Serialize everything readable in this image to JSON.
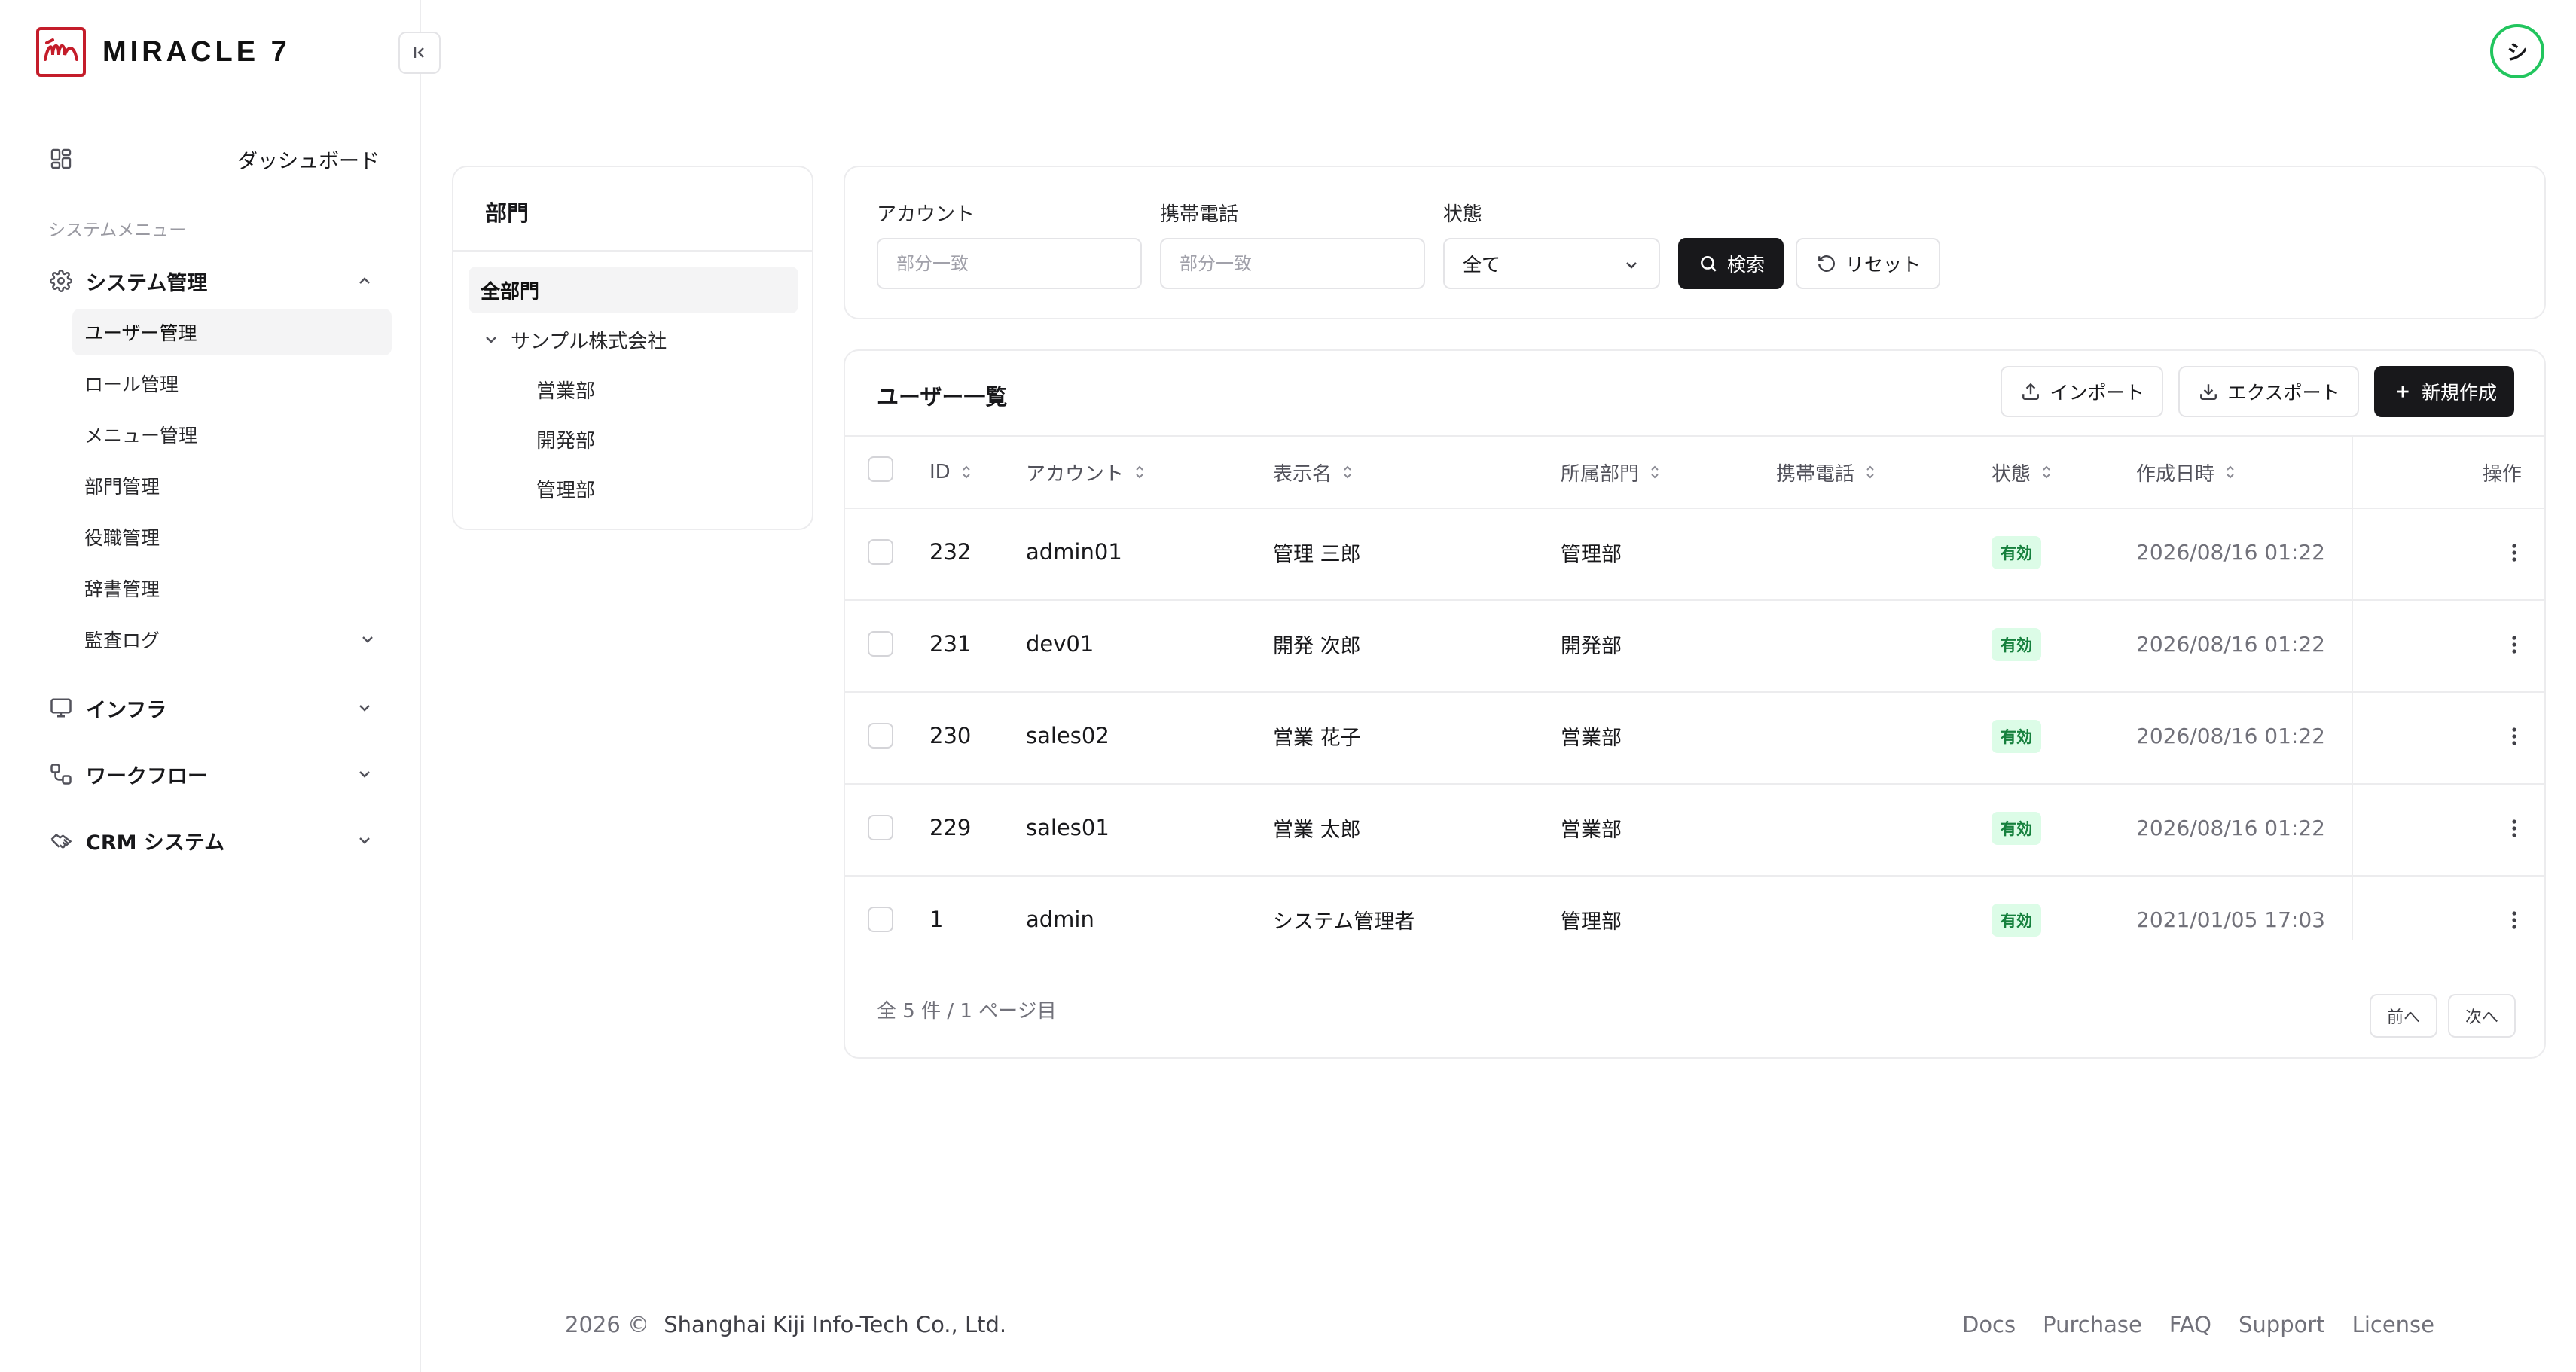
{
  "brand": {
    "name": "MIRACLE 7",
    "color": "#c41d2a"
  },
  "header": {
    "avatar_initial": "シ",
    "avatar_ring_color": "#22c55e"
  },
  "sidebar": {
    "dashboard_label": "ダッシュボード",
    "section_label": "システムメニュー",
    "system_group": {
      "label": "システム管理",
      "expanded": true,
      "items": [
        {
          "label": "ユーザー管理",
          "active": true
        },
        {
          "label": "ロール管理"
        },
        {
          "label": "メニュー管理"
        },
        {
          "label": "部門管理"
        },
        {
          "label": "役職管理"
        },
        {
          "label": "辞書管理"
        },
        {
          "label": "監査ログ",
          "has_children": true
        }
      ]
    },
    "groups": [
      {
        "label": "インフラ",
        "icon": "monitor-icon"
      },
      {
        "label": "ワークフロー",
        "icon": "workflow-icon"
      },
      {
        "label": "CRM システム",
        "icon": "handshake-icon"
      }
    ]
  },
  "dept_panel": {
    "title": "部門",
    "all_label": "全部門",
    "company": "サンプル株式会社",
    "departments": [
      "営業部",
      "開発部",
      "管理部"
    ]
  },
  "filters": {
    "account": {
      "label": "アカウント",
      "placeholder": "部分一致",
      "value": ""
    },
    "phone": {
      "label": "携帯電話",
      "placeholder": "部分一致",
      "value": ""
    },
    "status": {
      "label": "状態",
      "selected": "全て"
    },
    "search_button": "検索",
    "reset_button": "リセット"
  },
  "table": {
    "title": "ユーザー一覧",
    "import_button": "インポート",
    "export_button": "エクスポート",
    "create_button": "新規作成",
    "columns": [
      "ID",
      "アカウント",
      "表示名",
      "所属部門",
      "携帯電話",
      "状態",
      "作成日時",
      "操作"
    ],
    "rows": [
      {
        "id": "232",
        "account": "admin01",
        "display_name": "管理 三郎",
        "dept": "管理部",
        "phone": "",
        "status": "有効",
        "created": "2026/08/16 01:22"
      },
      {
        "id": "231",
        "account": "dev01",
        "display_name": "開発 次郎",
        "dept": "開発部",
        "phone": "",
        "status": "有効",
        "created": "2026/08/16 01:22"
      },
      {
        "id": "230",
        "account": "sales02",
        "display_name": "営業 花子",
        "dept": "営業部",
        "phone": "",
        "status": "有効",
        "created": "2026/08/16 01:22"
      },
      {
        "id": "229",
        "account": "sales01",
        "display_name": "営業 太郎",
        "dept": "営業部",
        "phone": "",
        "status": "有効",
        "created": "2026/08/16 01:22"
      },
      {
        "id": "1",
        "account": "admin",
        "display_name": "システム管理者",
        "dept": "管理部",
        "phone": "",
        "status": "有効",
        "created": "2021/01/05 17:03"
      }
    ],
    "summary": "全 5 件 / 1 ページ目",
    "prev_button": "前へ",
    "next_button": "次へ",
    "status_badge_colors": {
      "bg": "#dcfce7",
      "text": "#15803d"
    }
  },
  "footer": {
    "year": "2026 ©",
    "company": "Shanghai Kiji Info-Tech Co., Ltd.",
    "links": [
      "Docs",
      "Purchase",
      "FAQ",
      "Support",
      "License"
    ]
  }
}
